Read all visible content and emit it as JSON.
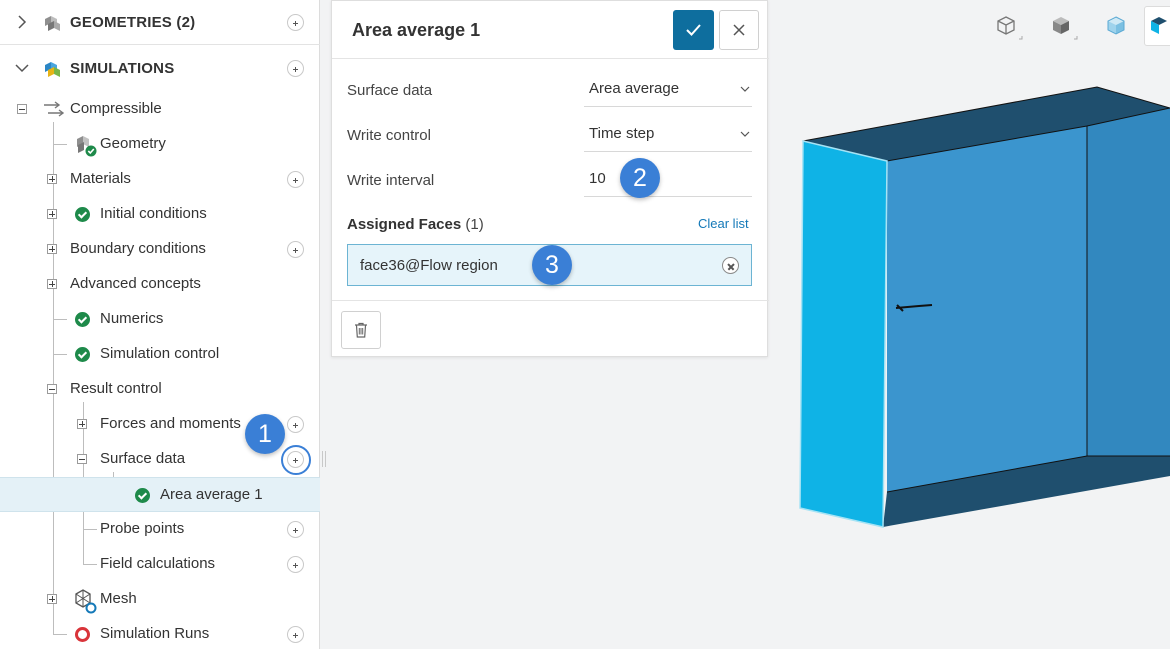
{
  "tree": {
    "geometries": {
      "label": "GEOMETRIES (2)"
    },
    "simulations": {
      "label": "SIMULATIONS"
    },
    "items": [
      {
        "label": "Compressible"
      },
      {
        "label": "Geometry"
      },
      {
        "label": "Materials"
      },
      {
        "label": "Initial conditions"
      },
      {
        "label": "Boundary conditions"
      },
      {
        "label": "Advanced concepts"
      },
      {
        "label": "Numerics"
      },
      {
        "label": "Simulation control"
      },
      {
        "label": "Result control"
      },
      {
        "label": "Forces and moments"
      },
      {
        "label": "Surface data"
      },
      {
        "label": "Area average 1"
      },
      {
        "label": "Probe points"
      },
      {
        "label": "Field calculations"
      },
      {
        "label": "Mesh"
      },
      {
        "label": "Simulation Runs"
      }
    ]
  },
  "panel": {
    "title": "Area average 1",
    "fields": [
      {
        "label": "Surface data",
        "value": "Area average"
      },
      {
        "label": "Write control",
        "value": "Time step"
      },
      {
        "label": "Write interval",
        "value": "10"
      }
    ],
    "assigned_faces": {
      "label": "Assigned Faces",
      "count": "(1)",
      "clear_label": "Clear list",
      "faces": [
        "face36@Flow region"
      ]
    }
  },
  "markers": [
    "1",
    "2",
    "3"
  ],
  "colors": {
    "accent": "#0e6e9e",
    "marker": "#3a7fd6",
    "success": "#1e8a4a",
    "error": "#d9343a",
    "selected_row": "#e4f1f7",
    "box_front": "#0fb3e6",
    "box_inner": "#3b95ce",
    "box_top": "#1f4f6e"
  },
  "icons": {
    "confirm": "checkmark-icon",
    "close": "close-icon",
    "delete": "trash-icon"
  }
}
